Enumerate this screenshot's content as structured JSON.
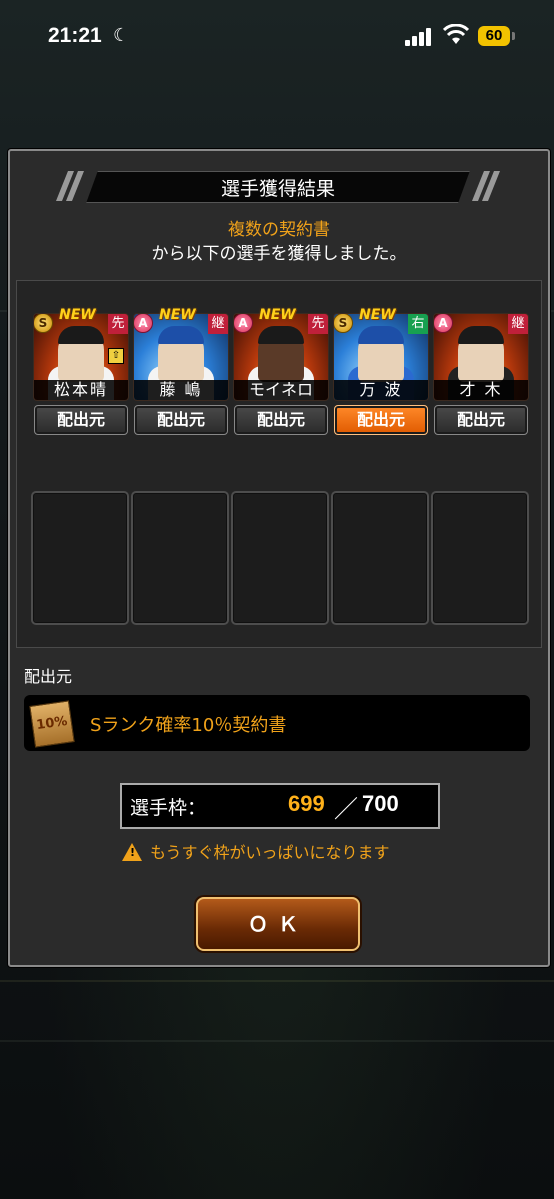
{
  "status_bar": {
    "time": "21:21",
    "battery": "60"
  },
  "dialog": {
    "title": "選手獲得結果",
    "message_highlight": "複数の契約書",
    "message": "から以下の選手を獲得しました。"
  },
  "players": [
    {
      "name": "松本晴",
      "rank": "S",
      "role": "先",
      "new": "NEW",
      "source_label": "配出元"
    },
    {
      "name": "藤 嶋",
      "rank": "A",
      "role": "継",
      "new": "NEW",
      "source_label": "配出元"
    },
    {
      "name": "モイネロ",
      "rank": "A",
      "role": "先",
      "new": "NEW",
      "source_label": "配出元"
    },
    {
      "name": "万 波",
      "rank": "S",
      "role": "右",
      "new": "NEW",
      "source_label": "配出元"
    },
    {
      "name": "才 木",
      "rank": "A",
      "role": "継",
      "new": "",
      "source_label": "配出元"
    }
  ],
  "source": {
    "label": "配出元",
    "contract_icon_text": "10%",
    "contract_name": "Sランク確率10％契約書"
  },
  "roster": {
    "label": "選手枠：",
    "current": "699",
    "separator": "／",
    "max": "700",
    "warning": "もうすぐ枠がいっぱいになります"
  },
  "ok_button": "ＯＫ"
}
